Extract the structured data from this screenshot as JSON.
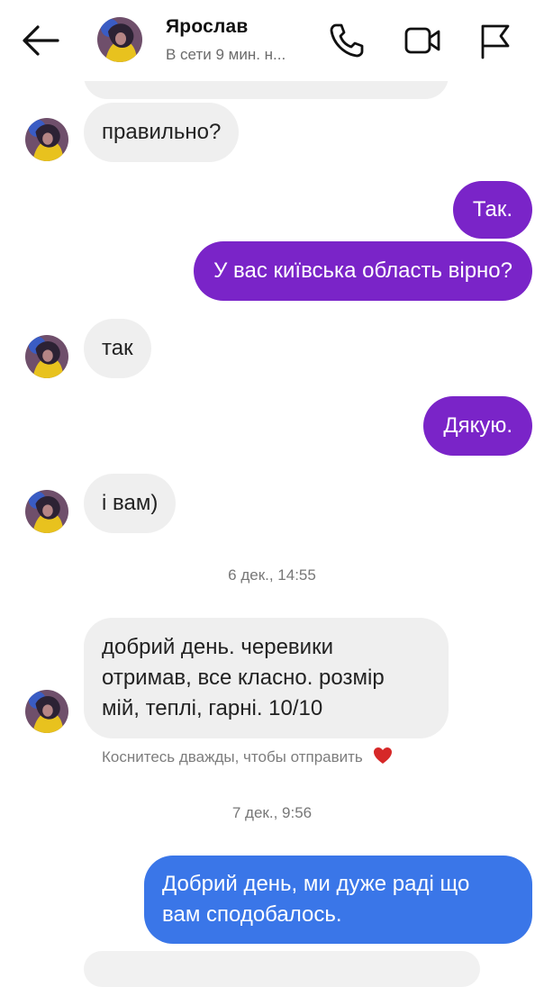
{
  "header": {
    "contact_name": "Ярослав",
    "status": "В сети 9 мин. н...",
    "back_icon": "arrow-left-icon",
    "call_icon": "phone-icon",
    "video_icon": "video-camera-icon",
    "flag_icon": "flag-icon"
  },
  "messages": [
    {
      "text": "правильно?",
      "direction": "incoming"
    },
    {
      "text": "Так.",
      "direction": "outgoing"
    },
    {
      "text": "У вас київська область вірно?",
      "direction": "outgoing"
    },
    {
      "text": "так",
      "direction": "incoming"
    },
    {
      "text": "Дякую.",
      "direction": "outgoing"
    },
    {
      "text": "і вам)",
      "direction": "incoming"
    },
    {
      "lines": [
        "добрий день. черевики",
        "отримав, все класно. розмір",
        "мій, теплі, гарні. 10/10"
      ],
      "direction": "incoming"
    },
    {
      "lines": [
        "Добрий день, ми дуже раді що",
        "вам сподобалось."
      ],
      "direction": "outgoing"
    }
  ],
  "timestamps": [
    "6 дек., 14:55",
    "7 дек., 9:56"
  ],
  "hint": {
    "text": "Коснитесь дважды, чтобы отправить",
    "icon": "heart-icon"
  },
  "colors": {
    "outgoing_purple": "#7a24c8",
    "outgoing_blue": "#3a76e8",
    "incoming_bg": "#efefef",
    "heart": "#d62828"
  }
}
